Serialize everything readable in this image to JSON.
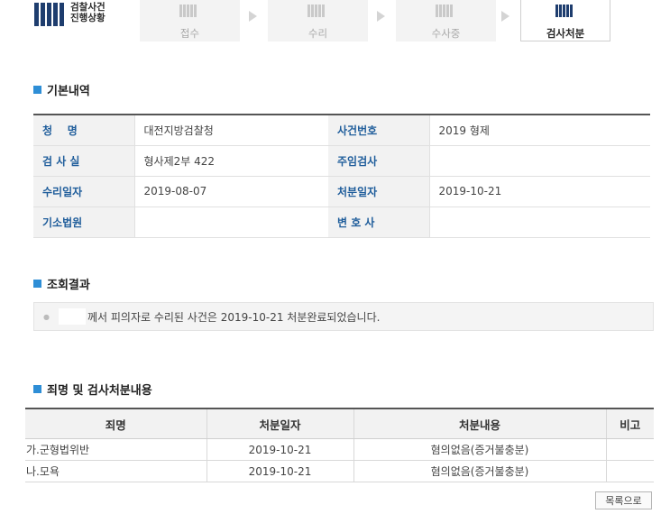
{
  "header": {
    "logo_line1": "검찰사건",
    "logo_line2": "진행상황",
    "steps": [
      {
        "label": "접수",
        "active": false
      },
      {
        "label": "수리",
        "active": false
      },
      {
        "label": "수사중",
        "active": false
      },
      {
        "label": "검사처분",
        "active": true
      }
    ]
  },
  "basic_info": {
    "title": "기본내역",
    "rows": [
      {
        "label1": "청    명",
        "value1": "대전지방검찰청",
        "label2": "사건번호",
        "value2": "2019 형제"
      },
      {
        "label1": "검 사 실",
        "value1": "형사제2부 422",
        "label2": "주임검사",
        "value2": ""
      },
      {
        "label1": "수리일자",
        "value1": "2019-08-07",
        "label2": "처분일자",
        "value2": "2019-10-21"
      },
      {
        "label1": "기소법원",
        "value1": "",
        "label2": "변 호 사",
        "value2": ""
      }
    ]
  },
  "result": {
    "title": "조회결과",
    "message": "께서 피의자로 수리된 사건은 2019-10-21 처분완료되었습니다."
  },
  "charges": {
    "title": "죄명 및 검사처분내용",
    "headers": [
      "죄명",
      "처분일자",
      "처분내용",
      "비고"
    ],
    "rows": [
      [
        "가.군형법위반",
        "2019-10-21",
        "혐의없음(증거불충분)",
        ""
      ],
      [
        "나.모욕",
        "2019-10-21",
        "혐의없음(증거불충분)",
        ""
      ]
    ]
  },
  "buttons": {
    "list": "목록으로"
  },
  "colors": {
    "accent": "#2e8ed6",
    "label_blue": "#1f5d9b",
    "navy": "#1e3d6e"
  }
}
